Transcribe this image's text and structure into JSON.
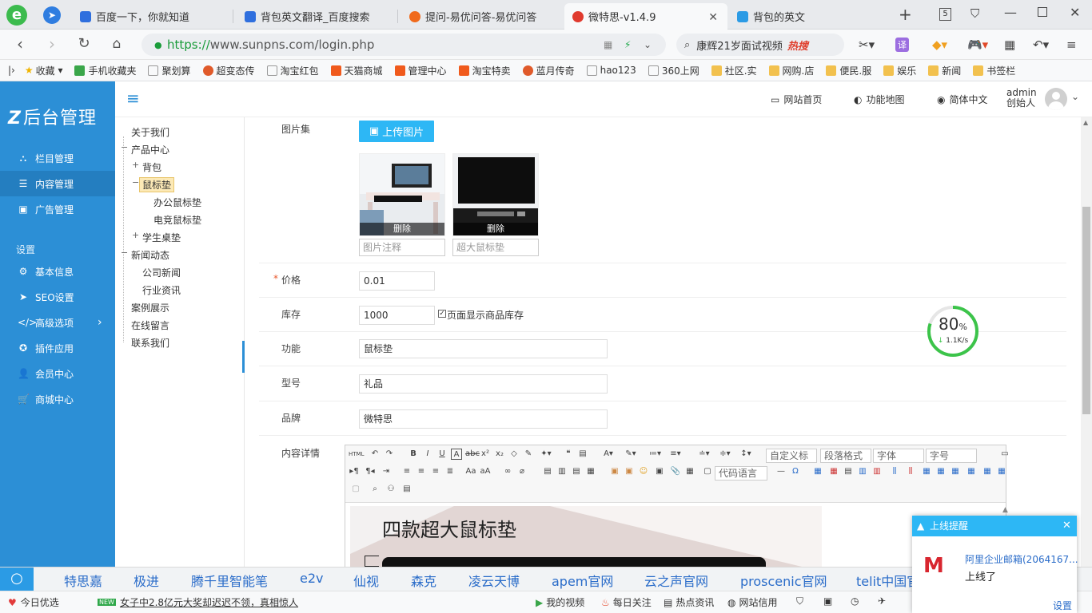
{
  "browser": {
    "tabs": [
      {
        "title": "百度一下，你就知道",
        "color": "#2f6fde"
      },
      {
        "title": "背包英文翻译_百度搜索",
        "color": "#2f6fde"
      },
      {
        "title": "提问-易优问答-易优问答",
        "color": "#f06a1c"
      },
      {
        "title": "微特思-v1.4.9",
        "color": "#e03a2e"
      },
      {
        "title": "背包的英文",
        "color": "#2b9be5"
      }
    ],
    "tab_count": "5",
    "url_scheme": "https://",
    "url_rest": "www.sunpns.com/login.php",
    "search_text": "康辉21岁面试视频",
    "search_hot": "热搜",
    "bookmarks": [
      "收藏",
      "手机收藏夹",
      "聚划算",
      "超变态传",
      "淘宝红包",
      "天猫商城",
      "管理中心",
      "淘宝特卖",
      "蓝月传奇",
      "hao123",
      "360上网",
      "社区.实",
      "网购.店",
      "便民.服",
      "娱乐",
      "新闻",
      "书签栏"
    ]
  },
  "admin": {
    "logo": "后台管理",
    "menu": [
      {
        "label": "栏目管理",
        "icon": "sitemap-icon"
      },
      {
        "label": "内容管理",
        "icon": "list-icon",
        "active": true
      },
      {
        "label": "广告管理",
        "icon": "image-icon"
      }
    ],
    "settings_heading": "设置",
    "settings_menu": [
      {
        "label": "基本信息",
        "icon": "gear-icon"
      },
      {
        "label": "SEO设置",
        "icon": "send-icon"
      },
      {
        "label": "高级选项",
        "icon": "code-icon"
      },
      {
        "label": "插件应用",
        "icon": "plugin-icon"
      },
      {
        "label": "会员中心",
        "icon": "user-icon"
      },
      {
        "label": "商城中心",
        "icon": "cart-icon"
      }
    ],
    "topbar": {
      "site_home": "网站首页",
      "sitemap": "功能地图",
      "language": "简体中文",
      "user_name": "admin",
      "user_role": "创始人"
    },
    "tree": [
      "关于我们",
      "产品中心",
      "背包",
      "鼠标垫",
      "办公鼠标垫",
      "电竞鼠标垫",
      "学生桌垫",
      "新闻动态",
      "公司新闻",
      "行业资讯",
      "案例展示",
      "在线留言",
      "联系我们"
    ],
    "form": {
      "gallery_label": "图片集",
      "upload_btn": "上传图片",
      "delete_label": "删除",
      "captions": [
        "图片注释",
        "超大鼠标垫"
      ],
      "price_label": "价格",
      "price": "0.01",
      "stock_label": "库存",
      "stock": "1000",
      "stock_show": "页面显示商品库存",
      "func_label": "功能",
      "func": "鼠标垫",
      "model_label": "型号",
      "model": "礼品",
      "brand_label": "品牌",
      "brand": "微特思",
      "content_label": "内容详情",
      "editor_selects": [
        "自定义标",
        "段落格式",
        "字体",
        "字号"
      ],
      "code_lang": "代码语言",
      "content_title": "四款超大鼠标垫"
    }
  },
  "speed": {
    "percent": "80",
    "unit": "%",
    "rate": "1.1K/s"
  },
  "hotbar": [
    "特思嘉",
    "极进",
    "腾千里智能笔",
    "e2v",
    "仙视",
    "森克",
    "凌云天博",
    "apem官网",
    "云之声官网",
    "proscenic官网",
    "telit中国官"
  ],
  "status": {
    "today": "今日优选",
    "news": "女子中2.8亿元大奖却迟迟不领，真相惊人",
    "video": "我的视频",
    "follow": "每日关注",
    "hot": "热点资讯",
    "credit": "网站信用"
  },
  "popup": {
    "title": "上线提醒",
    "sender": "阿里企业邮箱(2064167...",
    "message": "上线了",
    "settings": "设置"
  }
}
